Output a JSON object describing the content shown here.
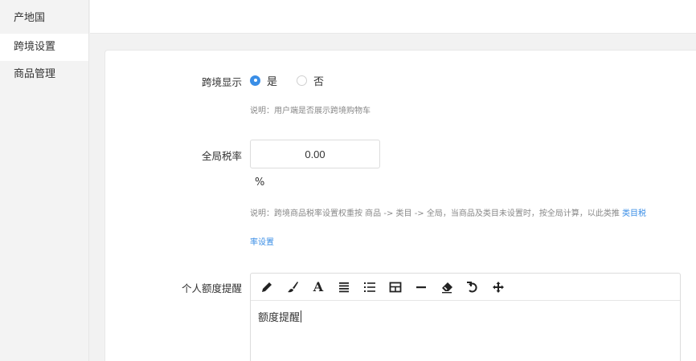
{
  "sidebar": {
    "items": [
      {
        "label": "产地国"
      },
      {
        "label": "跨境设置"
      },
      {
        "label": "商品管理"
      }
    ]
  },
  "form": {
    "cross_border": {
      "label": "跨境显示",
      "options": [
        {
          "label": "是",
          "checked": true
        },
        {
          "label": "否",
          "checked": false
        }
      ],
      "hint": "说明：用户端是否展示跨境购物车"
    },
    "tax": {
      "label": "全局税率",
      "value": "0.00",
      "unit": "%",
      "hint_text": "说明：跨境商品税率设置权重按 商品 -> 类目 -> 全局，当商品及类目未设置时，按全局计算，以此类推 ",
      "hint_link_1": "类目税",
      "hint_link_2": "率设置"
    },
    "quota": {
      "label": "个人额度提醒",
      "toolbar": [
        "pencil-icon",
        "brush-icon",
        "font-icon",
        "align-icon",
        "list-icon",
        "table-icon",
        "hr-icon",
        "eraser-icon",
        "undo-icon",
        "move-icon"
      ],
      "content": "额度提醒"
    }
  },
  "colors": {
    "accent": "#3a8ee6",
    "sidebar_bg": "#f3f3f3",
    "panel_bg": "#ffffff"
  }
}
